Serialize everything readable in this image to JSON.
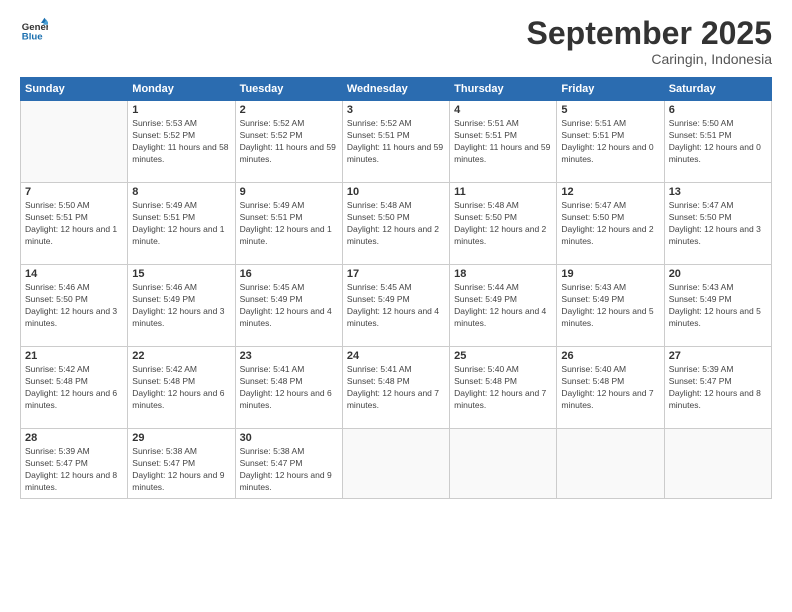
{
  "logo": {
    "line1": "General",
    "line2": "Blue"
  },
  "title": "September 2025",
  "subtitle": "Caringin, Indonesia",
  "days": [
    "Sunday",
    "Monday",
    "Tuesday",
    "Wednesday",
    "Thursday",
    "Friday",
    "Saturday"
  ],
  "weeks": [
    [
      {
        "day": "",
        "sunrise": "",
        "sunset": "",
        "daylight": ""
      },
      {
        "day": "1",
        "sunrise": "Sunrise: 5:53 AM",
        "sunset": "Sunset: 5:52 PM",
        "daylight": "Daylight: 11 hours and 58 minutes."
      },
      {
        "day": "2",
        "sunrise": "Sunrise: 5:52 AM",
        "sunset": "Sunset: 5:52 PM",
        "daylight": "Daylight: 11 hours and 59 minutes."
      },
      {
        "day": "3",
        "sunrise": "Sunrise: 5:52 AM",
        "sunset": "Sunset: 5:51 PM",
        "daylight": "Daylight: 11 hours and 59 minutes."
      },
      {
        "day": "4",
        "sunrise": "Sunrise: 5:51 AM",
        "sunset": "Sunset: 5:51 PM",
        "daylight": "Daylight: 11 hours and 59 minutes."
      },
      {
        "day": "5",
        "sunrise": "Sunrise: 5:51 AM",
        "sunset": "Sunset: 5:51 PM",
        "daylight": "Daylight: 12 hours and 0 minutes."
      },
      {
        "day": "6",
        "sunrise": "Sunrise: 5:50 AM",
        "sunset": "Sunset: 5:51 PM",
        "daylight": "Daylight: 12 hours and 0 minutes."
      }
    ],
    [
      {
        "day": "7",
        "sunrise": "Sunrise: 5:50 AM",
        "sunset": "Sunset: 5:51 PM",
        "daylight": "Daylight: 12 hours and 1 minute."
      },
      {
        "day": "8",
        "sunrise": "Sunrise: 5:49 AM",
        "sunset": "Sunset: 5:51 PM",
        "daylight": "Daylight: 12 hours and 1 minute."
      },
      {
        "day": "9",
        "sunrise": "Sunrise: 5:49 AM",
        "sunset": "Sunset: 5:51 PM",
        "daylight": "Daylight: 12 hours and 1 minute."
      },
      {
        "day": "10",
        "sunrise": "Sunrise: 5:48 AM",
        "sunset": "Sunset: 5:50 PM",
        "daylight": "Daylight: 12 hours and 2 minutes."
      },
      {
        "day": "11",
        "sunrise": "Sunrise: 5:48 AM",
        "sunset": "Sunset: 5:50 PM",
        "daylight": "Daylight: 12 hours and 2 minutes."
      },
      {
        "day": "12",
        "sunrise": "Sunrise: 5:47 AM",
        "sunset": "Sunset: 5:50 PM",
        "daylight": "Daylight: 12 hours and 2 minutes."
      },
      {
        "day": "13",
        "sunrise": "Sunrise: 5:47 AM",
        "sunset": "Sunset: 5:50 PM",
        "daylight": "Daylight: 12 hours and 3 minutes."
      }
    ],
    [
      {
        "day": "14",
        "sunrise": "Sunrise: 5:46 AM",
        "sunset": "Sunset: 5:50 PM",
        "daylight": "Daylight: 12 hours and 3 minutes."
      },
      {
        "day": "15",
        "sunrise": "Sunrise: 5:46 AM",
        "sunset": "Sunset: 5:49 PM",
        "daylight": "Daylight: 12 hours and 3 minutes."
      },
      {
        "day": "16",
        "sunrise": "Sunrise: 5:45 AM",
        "sunset": "Sunset: 5:49 PM",
        "daylight": "Daylight: 12 hours and 4 minutes."
      },
      {
        "day": "17",
        "sunrise": "Sunrise: 5:45 AM",
        "sunset": "Sunset: 5:49 PM",
        "daylight": "Daylight: 12 hours and 4 minutes."
      },
      {
        "day": "18",
        "sunrise": "Sunrise: 5:44 AM",
        "sunset": "Sunset: 5:49 PM",
        "daylight": "Daylight: 12 hours and 4 minutes."
      },
      {
        "day": "19",
        "sunrise": "Sunrise: 5:43 AM",
        "sunset": "Sunset: 5:49 PM",
        "daylight": "Daylight: 12 hours and 5 minutes."
      },
      {
        "day": "20",
        "sunrise": "Sunrise: 5:43 AM",
        "sunset": "Sunset: 5:49 PM",
        "daylight": "Daylight: 12 hours and 5 minutes."
      }
    ],
    [
      {
        "day": "21",
        "sunrise": "Sunrise: 5:42 AM",
        "sunset": "Sunset: 5:48 PM",
        "daylight": "Daylight: 12 hours and 6 minutes."
      },
      {
        "day": "22",
        "sunrise": "Sunrise: 5:42 AM",
        "sunset": "Sunset: 5:48 PM",
        "daylight": "Daylight: 12 hours and 6 minutes."
      },
      {
        "day": "23",
        "sunrise": "Sunrise: 5:41 AM",
        "sunset": "Sunset: 5:48 PM",
        "daylight": "Daylight: 12 hours and 6 minutes."
      },
      {
        "day": "24",
        "sunrise": "Sunrise: 5:41 AM",
        "sunset": "Sunset: 5:48 PM",
        "daylight": "Daylight: 12 hours and 7 minutes."
      },
      {
        "day": "25",
        "sunrise": "Sunrise: 5:40 AM",
        "sunset": "Sunset: 5:48 PM",
        "daylight": "Daylight: 12 hours and 7 minutes."
      },
      {
        "day": "26",
        "sunrise": "Sunrise: 5:40 AM",
        "sunset": "Sunset: 5:48 PM",
        "daylight": "Daylight: 12 hours and 7 minutes."
      },
      {
        "day": "27",
        "sunrise": "Sunrise: 5:39 AM",
        "sunset": "Sunset: 5:47 PM",
        "daylight": "Daylight: 12 hours and 8 minutes."
      }
    ],
    [
      {
        "day": "28",
        "sunrise": "Sunrise: 5:39 AM",
        "sunset": "Sunset: 5:47 PM",
        "daylight": "Daylight: 12 hours and 8 minutes."
      },
      {
        "day": "29",
        "sunrise": "Sunrise: 5:38 AM",
        "sunset": "Sunset: 5:47 PM",
        "daylight": "Daylight: 12 hours and 9 minutes."
      },
      {
        "day": "30",
        "sunrise": "Sunrise: 5:38 AM",
        "sunset": "Sunset: 5:47 PM",
        "daylight": "Daylight: 12 hours and 9 minutes."
      },
      {
        "day": "",
        "sunrise": "",
        "sunset": "",
        "daylight": ""
      },
      {
        "day": "",
        "sunrise": "",
        "sunset": "",
        "daylight": ""
      },
      {
        "day": "",
        "sunrise": "",
        "sunset": "",
        "daylight": ""
      },
      {
        "day": "",
        "sunrise": "",
        "sunset": "",
        "daylight": ""
      }
    ]
  ]
}
